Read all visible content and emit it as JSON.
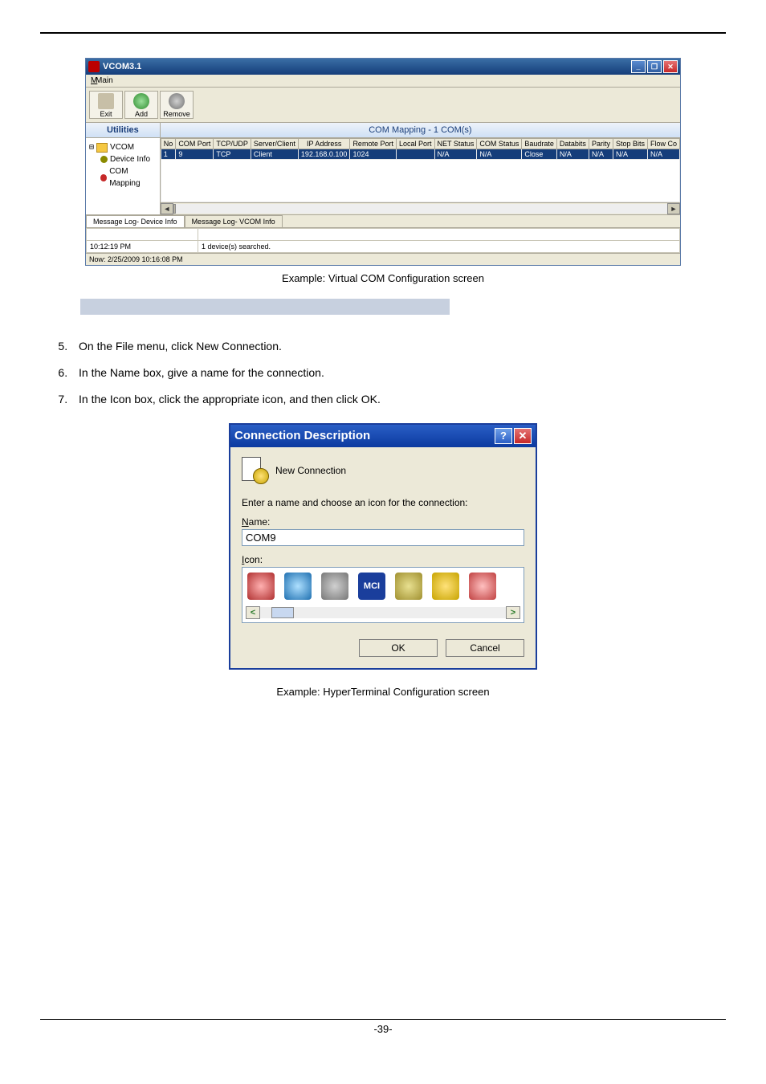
{
  "vcom": {
    "title": "VCOM3.1",
    "menu": "Main",
    "toolbar": {
      "exit": "Exit",
      "add": "Add",
      "remove": "Remove"
    },
    "side_head": "Utilities",
    "tree": {
      "root": "VCOM",
      "n1": "Device Info",
      "n2": "COM Mapping"
    },
    "main_head": "COM Mapping - 1 COM(s)",
    "headers": [
      "No",
      "COM Port",
      "TCP/UDP",
      "Server/Client",
      "IP Address",
      "Remote Port",
      "Local Port",
      "NET Status",
      "COM Status",
      "Baudrate",
      "Databits",
      "Parity",
      "Stop Bits",
      "Flow Co"
    ],
    "row": [
      "1",
      "9",
      "TCP",
      "Client",
      "192.168.0.100",
      "1024",
      "",
      "N/A",
      "N/A",
      "Close",
      "N/A",
      "N/A",
      "N/A",
      "N/A",
      "N/A"
    ],
    "tabs": {
      "t1": "Message Log- Device Info",
      "t2": "Message Log- VCOM Info"
    },
    "log": {
      "time": "10:12:19 PM",
      "msg": "1 device(s) searched."
    },
    "status": "Now: 2/25/2009 10:16:08 PM"
  },
  "caption1": "Example: Virtual COM Configuration screen",
  "steps": {
    "s5": "On the File menu, click New Connection.",
    "s6": "In the Name box, give a name for the connection.",
    "s7": "In the Icon box, click the appropriate icon, and then click OK."
  },
  "dlg": {
    "title": "Connection Description",
    "new_conn": "New Connection",
    "prompt": "Enter a name and choose an icon for the connection:",
    "name_label": "Name:",
    "name_value": "COM9",
    "icon_label": "Icon:",
    "mci": "MCI",
    "ok": "OK",
    "cancel": "Cancel"
  },
  "caption2": "Example: HyperTerminal Configuration screen",
  "pageno": "-39-"
}
